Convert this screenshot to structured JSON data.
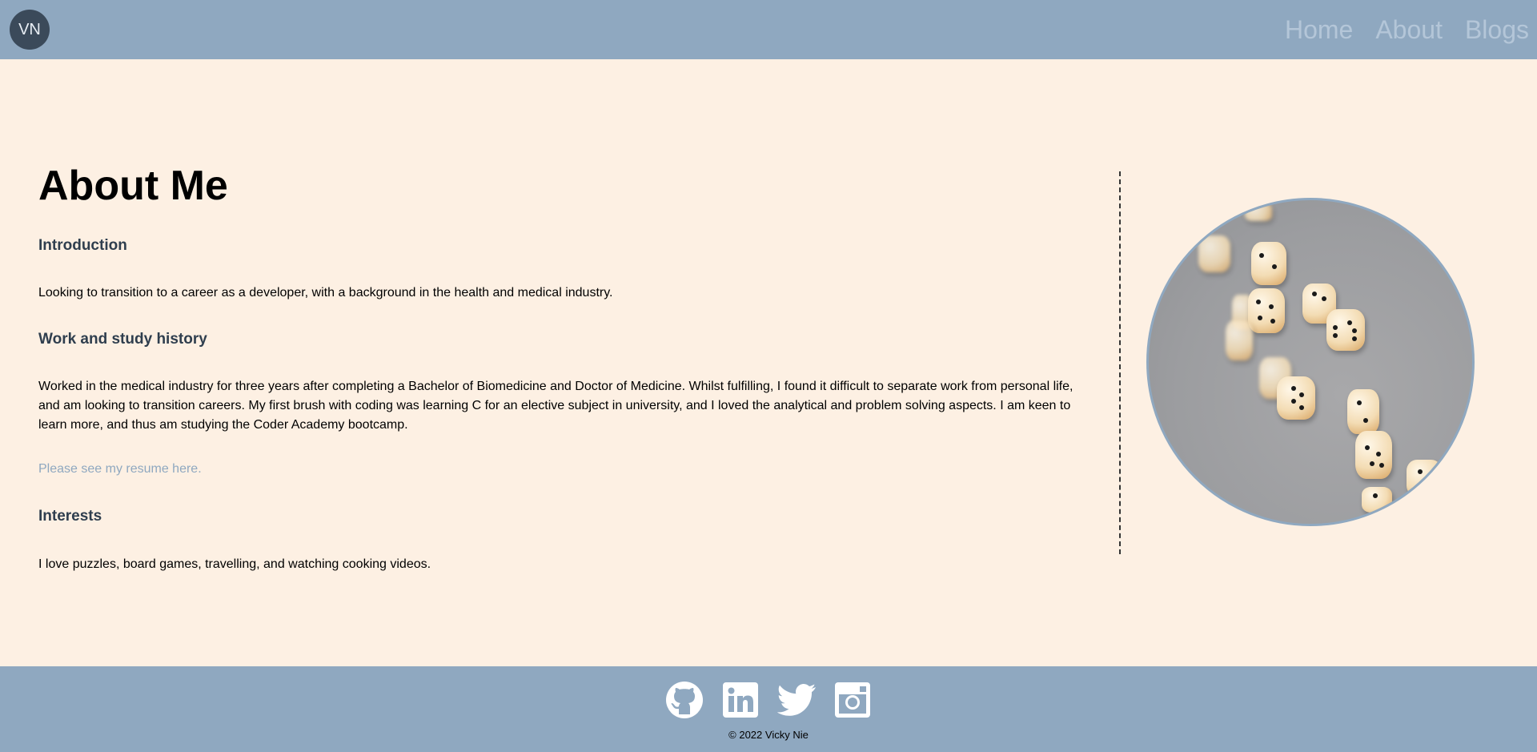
{
  "nav": {
    "logo_text": "VN",
    "links": [
      {
        "label": "Home"
      },
      {
        "label": "About"
      },
      {
        "label": "Blogs"
      }
    ]
  },
  "main": {
    "title": "About Me",
    "sections": {
      "introduction": {
        "heading": "Introduction",
        "text": "Looking to transition to a career as a developer, with a background in the health and medical industry."
      },
      "work": {
        "heading": "Work and study history",
        "text": "Worked in the medical industry for three years after completing a Bachelor of Biomedicine and Doctor of Medicine. Whilst fulfilling, I found it difficult to separate work from personal life, and am looking to transition careers. My first brush with coding was learning C for an elective subject in university, and I loved the analytical and problem solving aspects. I am keen to learn more, and thus am studying the Coder Academy bootcamp.",
        "resume_link": "Please see my resume here."
      },
      "interests": {
        "heading": "Interests",
        "text": "I love puzzles, board games, travelling, and watching cooking videos."
      }
    },
    "photo": {
      "subject": "falling-dice-photo"
    }
  },
  "footer": {
    "social_icons": [
      "github-icon",
      "linkedin-icon",
      "twitter-icon",
      "instagram-icon"
    ],
    "copyright": "© 2022 Vicky Nie"
  },
  "colors": {
    "nav_bg": "#8fa8c0",
    "page_bg": "#fdf0e3",
    "logo_bg": "#3b4a5a",
    "heading": "#2f3e4e",
    "link": "#8fa8c0"
  }
}
